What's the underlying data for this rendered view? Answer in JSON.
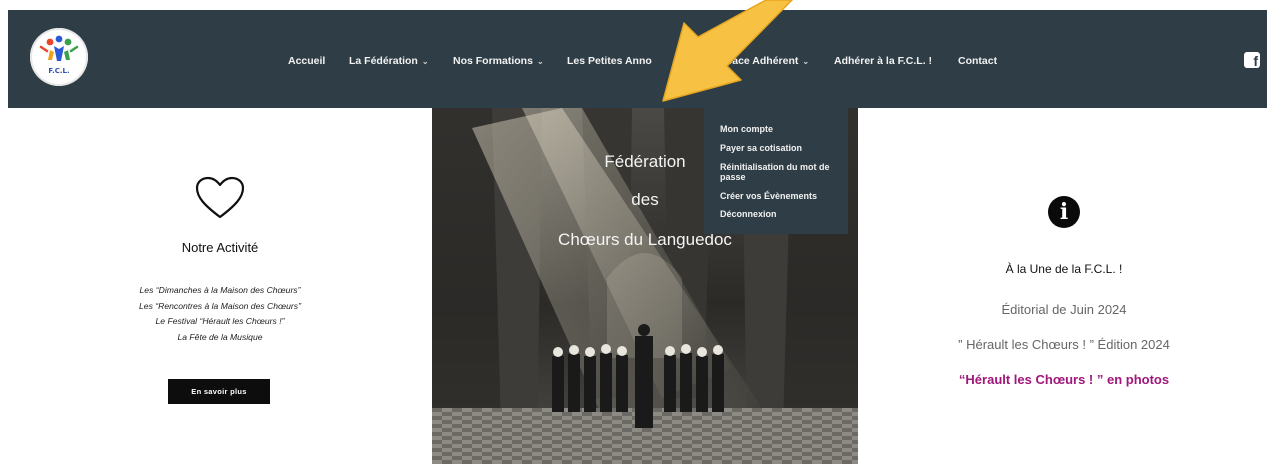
{
  "logo": {
    "text": "F.C.L."
  },
  "nav": {
    "items": [
      {
        "label": "Accueil",
        "has_dropdown": false
      },
      {
        "label": "La Fédération",
        "has_dropdown": true
      },
      {
        "label": "Nos Formations",
        "has_dropdown": true
      },
      {
        "label": "Les Petites Anno",
        "has_dropdown": false
      },
      {
        "label": "Espace Adhérent",
        "has_dropdown": true
      },
      {
        "label": "Adhérer à la F.C.L. !",
        "has_dropdown": false
      },
      {
        "label": "Contact",
        "has_dropdown": false
      }
    ],
    "chevron": "⌄",
    "social_icon": "facebook-icon"
  },
  "dropdown": {
    "items": [
      "Mon compte",
      "Payer sa cotisation",
      "Réinitialisation du mot de passe",
      "Créer vos Évènements",
      "Déconnexion"
    ]
  },
  "hero": {
    "line1": "Fédération",
    "line2": "des",
    "line3": "Chœurs du Languedoc"
  },
  "activity": {
    "icon": "heart-icon",
    "title": "Notre Activité",
    "lines": [
      "Les “Dimanches à la Maison des Chœurs”",
      "Les “Rencontres à la Maison des Chœurs”",
      "Le Festival “Hérault les Chœurs !”",
      "La Fête de la Musique"
    ],
    "button": "En savoir plus"
  },
  "news": {
    "icon": "info-icon",
    "title": "À la Une de la F.C.L. !",
    "line1": "Éditorial de Juin 2024",
    "line2": "” Hérault les Chœurs ! ”  Édition 2024",
    "link": "“Hérault les Chœurs ! ”  en photos"
  },
  "colors": {
    "navbar": "#2f3e46",
    "link_accent": "#a0167a",
    "arrow": "#f7c243"
  }
}
